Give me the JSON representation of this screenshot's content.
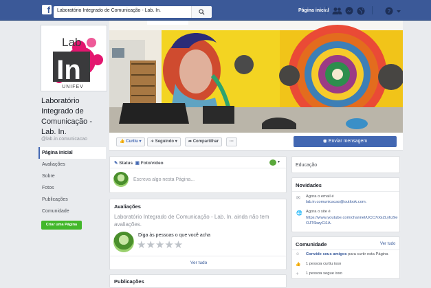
{
  "topbar": {
    "search_value": "Laboratório Integrado de Comunicação - Lab. In.",
    "home_label": "Página inicial"
  },
  "page": {
    "logo_lab": "Lab",
    "logo_in": "In",
    "logo_sub": "UNIFEV",
    "name": "Laboratório Integrado de Comunicação - Lab. In.",
    "handle": "@lab.in.comunicacao"
  },
  "leftnav": {
    "items": [
      "Página inicial",
      "Avaliações",
      "Sobre",
      "Fotos",
      "Publicações",
      "Comunidade"
    ],
    "create_page": "Criar uma Página"
  },
  "actions": {
    "like": "Curtiu",
    "follow": "Seguindo",
    "share": "Compartilhar",
    "more": "···",
    "send_message": "Enviar mensagem"
  },
  "composer": {
    "status_tab": "Status",
    "photo_tab": "Foto/vídeo",
    "placeholder": "Escreva algo nesta Página..."
  },
  "reviews": {
    "title": "Avaliações",
    "empty_text": "Laboratório Integrado de Comunicação - Lab. In. ainda não tem avaliações.",
    "prompt": "Diga às pessoas o que você acha",
    "see_all": "Ver tudo"
  },
  "posts": {
    "title": "Publicações"
  },
  "right": {
    "category": "Educação",
    "news_title": "Novidades",
    "email_label": "Agora o email é",
    "email": "lab.in.comunicacao@outlook.com.",
    "site_label": "Agora o site é",
    "site": "https://www.youtube.com/channel/UCC7oGZLyhz9eOJT6bzyCi1A.",
    "community_title": "Comunidade",
    "community_see_all": "Ver tudo",
    "invite": "Convide seus amigos",
    "invite_rest": " para curtir esta Página",
    "likes": "1 pessoa curtiu isso",
    "follows": "1 pessoa segue isso"
  },
  "colors": {
    "brand": "#3b5998",
    "accent": "#4267b2",
    "create": "#42b72a"
  }
}
